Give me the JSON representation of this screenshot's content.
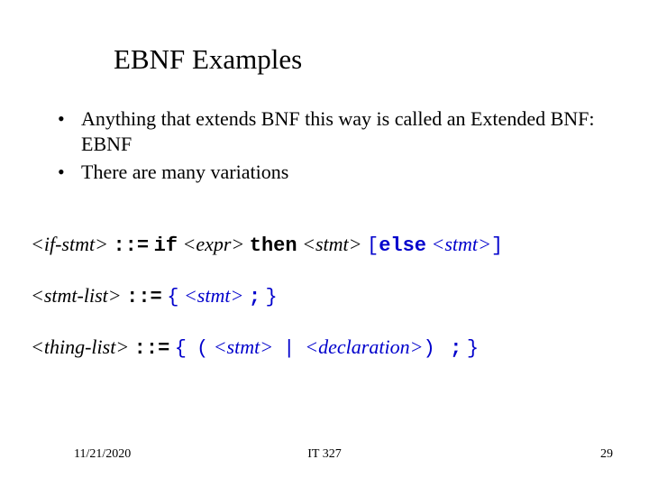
{
  "title": "EBNF Examples",
  "bullets": [
    "Anything that extends BNF this way is called an Extended BNF: EBNF",
    "There are many variations"
  ],
  "grammar": {
    "line1": {
      "lhs": "if-stmt",
      "op": "::=",
      "kw_if": "if",
      "expr": "expr",
      "kw_then": "then",
      "stmt1": "stmt",
      "lbr": "[",
      "kw_else": "else",
      "stmt2": "stmt",
      "rbr": "]"
    },
    "line2": {
      "lhs": "stmt-list",
      "op": "::=",
      "lbrace": "{",
      "stmt": "stmt",
      "semi": ";",
      "rbrace": "}"
    },
    "line3": {
      "lhs": "thing-list",
      "op": "::=",
      "lbrace": "{",
      "lparen": "(",
      "stmt": "stmt",
      "bar": "|",
      "decl": "declaration",
      "rparen": ")",
      "semi": ";",
      "rbrace": "}"
    }
  },
  "footer": {
    "date": "11/21/2020",
    "course": "IT 327",
    "page": "29"
  }
}
